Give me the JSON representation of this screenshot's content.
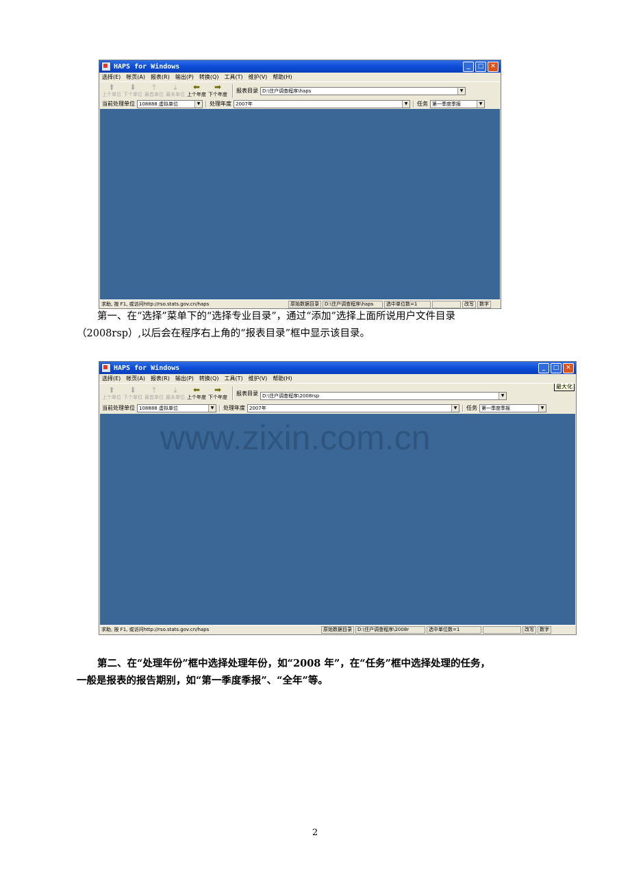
{
  "window1": {
    "title": "HAPS for Windows",
    "menu": [
      "选择(E)",
      "帐页(A)",
      "报表(R)",
      "输出(P)",
      "转换(Q)",
      "工具(T)",
      "维护(V)",
      "帮助(H)"
    ],
    "toolbar": [
      "上个单位",
      "下个单位",
      "最首单位",
      "最末单位",
      "上个年度",
      "下个年度"
    ],
    "report_dir_label": "报表目录",
    "report_dir_value": "D:\\住户调查程序\\haps",
    "unit_label": "当前处理单位",
    "unit_value": "108888 虚拟单位",
    "year_label": "处理年度",
    "year_value": "2007年",
    "task_label": "任务",
    "task_value": "第一季度季报",
    "status_help": "求助, 按 F1, 或访问http://rso.stats.gov.cn/haps",
    "status_data_label": "原始数据目录",
    "status_data_value": "D:\\住户调查程序\\haps",
    "status_selected": "选中单位数=1",
    "status_ovr": "改写",
    "status_num": "数字"
  },
  "paragraph1": {
    "line1": "第一、在“选择”菜单下的“选择专业目录”，通过“添加”选择上面所说用户文件目录",
    "line2": "（2008rsp）,以后会在程序右上角的“报表目录”框中显示该目录。"
  },
  "window2": {
    "title": "HAPS for Windows",
    "menu": [
      "选择(E)",
      "帐页(A)",
      "报表(R)",
      "输出(P)",
      "转换(Q)",
      "工具(T)",
      "维护(V)",
      "帮助(H)"
    ],
    "toolbar": [
      "上个单位",
      "下个单位",
      "最首单位",
      "最末单位",
      "上个年度",
      "下个年度"
    ],
    "maximize_tooltip": "最大化",
    "report_dir_label": "报表目录",
    "report_dir_value": "D:\\住户调查程序\\2008rsp",
    "unit_label": "当前处理单位",
    "unit_value": "108888 虚拟单位",
    "year_label": "处理年度",
    "year_value": "2007年",
    "task_label": "任务",
    "task_value": "第一季度季报",
    "status_help": "求助, 按 F1, 或访问http://rso.stats.gov.cn/haps",
    "status_data_label": "原始数据目录",
    "status_data_value": "D:\\住户调查程序\\2008r",
    "status_selected": "选中单位数=1",
    "status_ovr": "改写",
    "status_num": "数字"
  },
  "watermark": "www.zixin.com.cn",
  "paragraph2": {
    "line1": "第二、在“处理年份”框中选择处理年份，如“2008 年”，在“任务”框中选择处理的任务，",
    "line2": "一般是报表的报告期别，如“第一季度季报”、“全年”等。"
  },
  "page_number": "2"
}
